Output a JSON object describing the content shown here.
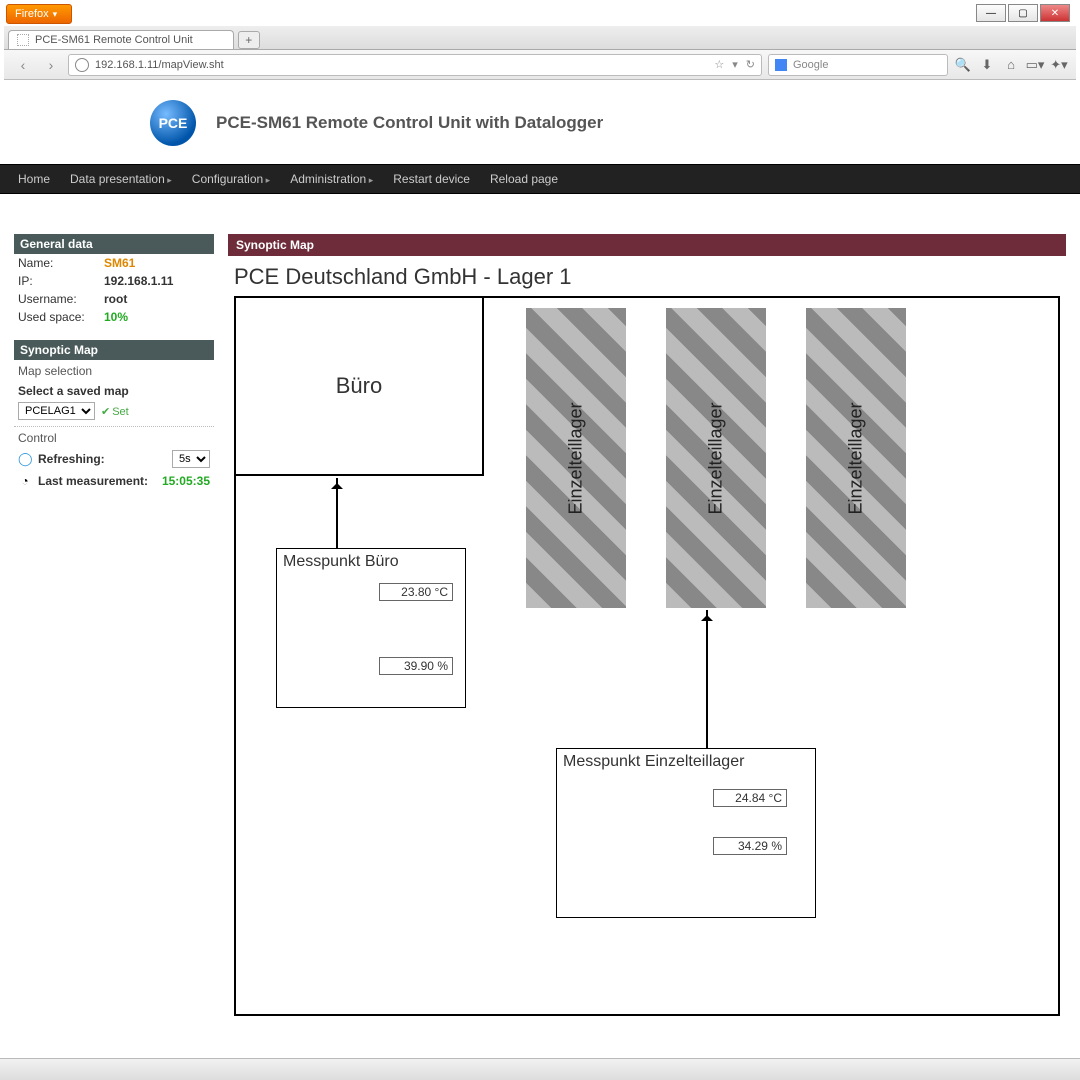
{
  "browser": {
    "menu_label": "Firefox",
    "tab_title": "PCE-SM61 Remote Control Unit",
    "url": "192.168.1.11/mapView.sht",
    "search_placeholder": "Google"
  },
  "toolbar_icons": {
    "back": "‹",
    "fwd": "›",
    "star": "☆",
    "drop": "▾",
    "reload": "↻",
    "search": "🔍",
    "down": "⬇",
    "home": "⌂",
    "book": "▭▾",
    "ext": "✦▾"
  },
  "brand": {
    "logo_text": "PCE",
    "title": "PCE-SM61 Remote Control Unit with Datalogger"
  },
  "nav": {
    "home": "Home",
    "data": "Data presentation",
    "config": "Configuration",
    "admin": "Administration",
    "restart": "Restart device",
    "reload": "Reload page"
  },
  "general": {
    "header": "General data",
    "name_k": "Name:",
    "name_v": "SM61",
    "ip_k": "IP:",
    "ip_v": "192.168.1.11",
    "user_k": "Username:",
    "user_v": "root",
    "space_k": "Used space:",
    "space_v": "10%"
  },
  "mapsel": {
    "header": "Synoptic Map",
    "sel_label": "Map selection",
    "saved_label": "Select a saved map",
    "dropdown": "PCELAG1",
    "set": "Set",
    "ctrl_label": "Control",
    "refresh_k": "Refreshing:",
    "refresh_v": "5s",
    "last_k": "Last measurement:",
    "last_v": "15:05:35"
  },
  "main": {
    "header": "Synoptic Map",
    "title": "PCE Deutschland GmbH - Lager 1",
    "office": "Büro",
    "shelf": "Einzelteillager",
    "mp1": {
      "title": "Messpunkt Büro",
      "temp": "23.80 °C",
      "hum": "39.90 %"
    },
    "mp2": {
      "title": "Messpunkt Einzelteillager",
      "temp": "24.84 °C",
      "hum": "34.29 %"
    }
  }
}
